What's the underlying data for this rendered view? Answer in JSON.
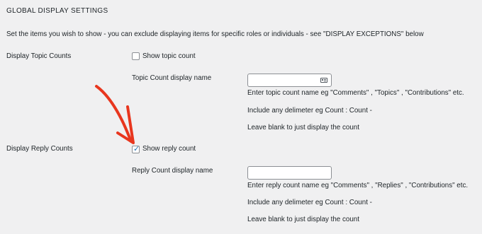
{
  "section": {
    "heading": "GLOBAL DISPLAY SETTINGS",
    "intro": "Set the items you wish to show - you can exclude displaying items for specific roles or individuals - see \"DISPLAY EXCEPTIONS\" below"
  },
  "topic_counts": {
    "row_label": "Display Topic Counts",
    "checkbox_label": "Show topic count",
    "checked": false,
    "name_label": "Topic Count display name",
    "input_value": "",
    "help_1": "Enter topic count name eg \"Comments\" , \"Topics\" , \"Contributions\" etc.",
    "help_2": "Include any delimeter eg Count : Count -",
    "help_3": "Leave blank to just display the count"
  },
  "reply_counts": {
    "row_label": "Display Reply Counts",
    "checkbox_label": "Show reply count",
    "checked": true,
    "name_label": "Reply Count display name",
    "input_value": "",
    "help_1": "Enter reply count name eg \"Comments\" , \"Replies\" , \"Contributions\" etc.",
    "help_2": "Include any delimeter eg Count : Count -",
    "help_3": "Leave blank to just display the count"
  },
  "colors": {
    "background": "#f0f0f1",
    "text": "#1d2327",
    "checkmark": "#2271b1",
    "annotation_arrow": "#e8361e"
  },
  "icons": {
    "input_autofill": "contact-card-icon",
    "checkbox_tick": "checkmark-icon"
  }
}
